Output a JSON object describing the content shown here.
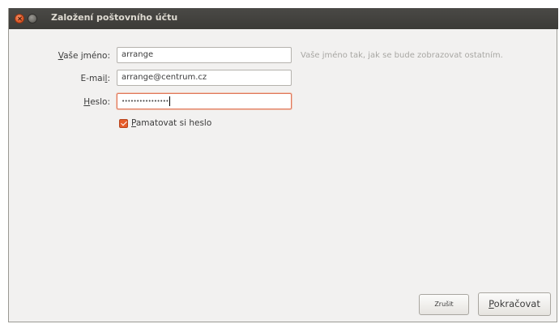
{
  "window": {
    "title": "Založení poštovního účtu"
  },
  "form": {
    "name_label_mnemonic": "V",
    "name_label_rest": "aše jméno:",
    "name_value": "arrange",
    "name_hint": "Vaše jméno tak, jak se bude zobrazovat ostatním.",
    "email_label_main": "E-mai",
    "email_label_mnemonic": "l",
    "email_label_colon": ":",
    "email_value": "arrange@centrum.cz",
    "password_label_mnemonic": "H",
    "password_label_rest": "eslo:",
    "password_value": "••••••••••••••••",
    "remember_mnemonic": "P",
    "remember_rest": "amatovat si heslo",
    "remember_checked": true
  },
  "buttons": {
    "cancel_label": "Zrušit",
    "continue_mnemonic": "P",
    "continue_rest": "okračovat"
  },
  "colors": {
    "titlebar": "#3c3b37",
    "accent": "#e65c2a",
    "window_bg": "#f2f1f0"
  }
}
